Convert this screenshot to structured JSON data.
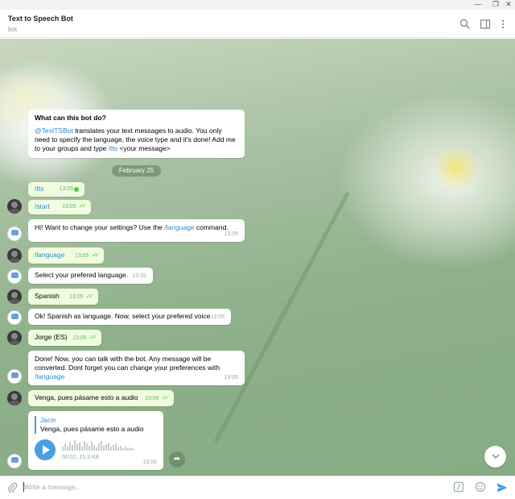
{
  "window": {
    "minimize": "—",
    "restore": "❐",
    "close": "✕"
  },
  "header": {
    "title": "Text to Speech Bot",
    "subtitle": "bot"
  },
  "intro": {
    "heading": "What can this bot do?",
    "handle": "@TextTSBot",
    "text1": " translates your text messages to audio. You only need to specify the language, the voice type and it's done! Add me to your groups and type ",
    "command": "/tts",
    "text2": " <your message>"
  },
  "date_label": "February 25",
  "messages": {
    "m1": {
      "text": "/tts",
      "time": "13:05"
    },
    "m2": {
      "text": "/start",
      "time": "13:05"
    },
    "m3": {
      "text": "Hi! Want to change your settings? Use the ",
      "link": "/language",
      "text_after": " command.",
      "time": "13:05"
    },
    "m4": {
      "text": "/language",
      "time": "13:05"
    },
    "m5": {
      "text": "Select your prefered language.",
      "time": "13:05"
    },
    "m6": {
      "text": "Spanish",
      "time": "13:05"
    },
    "m7": {
      "text": "Ok! Spanish as language. Now, select your prefered voice",
      "time": "13:05"
    },
    "m8": {
      "text": "Jorge (ES)",
      "time": "13:05"
    },
    "m9": {
      "text": "Done! Now, you can talk with the bot. Any message will be converted. Dont forget you can change your preferences with ",
      "link": "/language",
      "time": "13:05"
    },
    "m10": {
      "text": "Venga, pues pásame esto a audio",
      "time": "13:06"
    },
    "m11": {
      "quote_name": "Jacin",
      "quote_text": "Venga, pues pásame esto a audio",
      "audio_meta": "00:02, 15.3 KB",
      "time": "13:06"
    }
  },
  "composer": {
    "placeholder": "Write a message..."
  },
  "icons": {
    "search": "search-icon",
    "sidebar": "sidebar-toggle-icon",
    "more": "more-vertical-icon",
    "attach": "paperclip-icon",
    "commands": "slash-commands-icon",
    "emoji": "emoji-icon",
    "send": "send-icon",
    "forward": "forward-icon",
    "scroll_down": "chevron-down-icon"
  },
  "colors": {
    "accent": "#2a8ad3",
    "outgoing_bubble": "#effdde",
    "read_check": "#5dc452"
  }
}
